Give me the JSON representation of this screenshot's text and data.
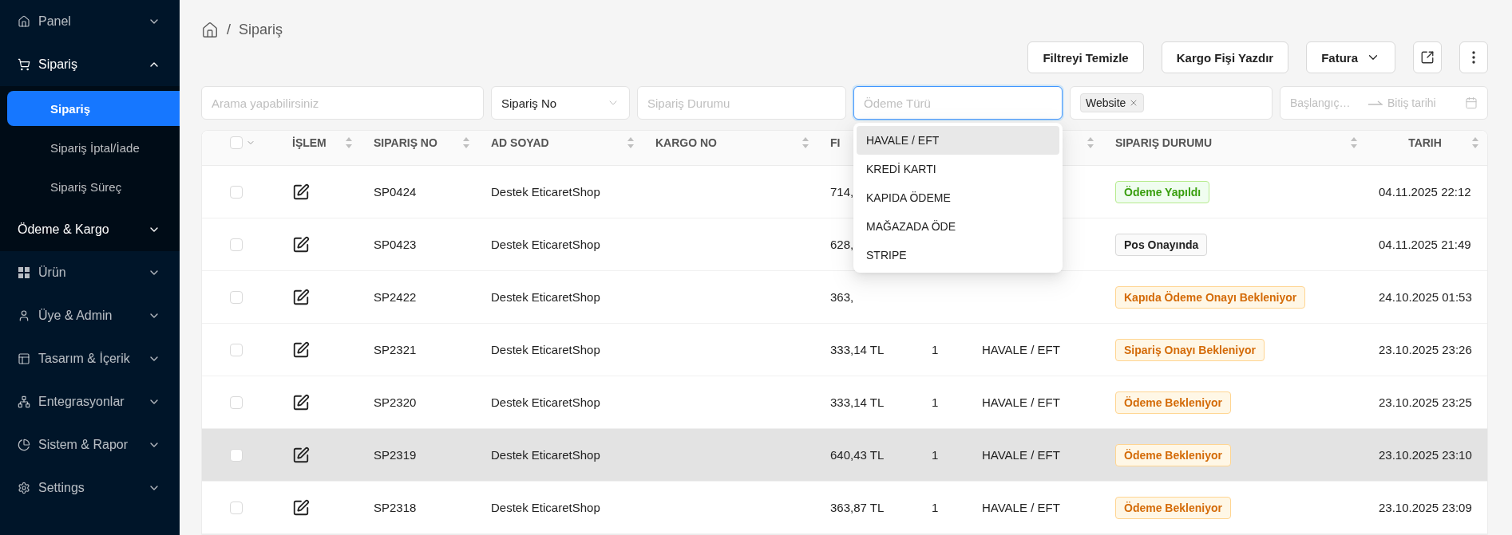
{
  "sidebar": {
    "items": [
      {
        "label": "Panel",
        "expanded": false
      },
      {
        "label": "Sipariş",
        "expanded": true,
        "children": [
          {
            "kind": "link",
            "label": "Sipariş",
            "selected": true
          },
          {
            "kind": "link",
            "label": "Sipariş İptal/İade",
            "selected": false
          },
          {
            "kind": "link",
            "label": "Sipariş Süreç",
            "selected": false
          },
          {
            "kind": "group",
            "label": "Ödeme & Kargo",
            "expanded": false
          }
        ]
      },
      {
        "label": "Ürün",
        "expanded": false
      },
      {
        "label": "Üye & Admin",
        "expanded": false
      },
      {
        "label": "Tasarım & İçerik",
        "expanded": false
      },
      {
        "label": "Entegrasyonlar",
        "expanded": false
      },
      {
        "label": "Sistem & Rapor",
        "expanded": false
      },
      {
        "label": "Settings",
        "expanded": false
      }
    ]
  },
  "breadcrumb": {
    "separator": "/",
    "current": "Sipariş"
  },
  "actions": [
    {
      "kind": "text",
      "label": "Filtreyi Temizle"
    },
    {
      "kind": "text",
      "label": "Kargo Fişi Yazdır"
    },
    {
      "kind": "menu",
      "label": "Fatura"
    },
    {
      "kind": "export"
    },
    {
      "kind": "more"
    }
  ],
  "filters": {
    "search": {
      "placeholder": "Arama yapabilirsiniz"
    },
    "search_field": {
      "value": "Sipariş No"
    },
    "order_status": {
      "placeholder": "Sipariş Durumu"
    },
    "payment_type": {
      "placeholder": "Ödeme Türü",
      "focused": true,
      "options": [
        {
          "label": "HAVALE / EFT",
          "selected": true
        },
        {
          "label": "KREDİ KARTI",
          "selected": false
        },
        {
          "label": "KAPIDA ÖDEME",
          "selected": false
        },
        {
          "label": "MAĞAZADA ÖDE",
          "selected": false
        },
        {
          "label": "STRIPE",
          "selected": false
        }
      ]
    },
    "source": {
      "tags": [
        "Website"
      ]
    },
    "date_range": {
      "start_placeholder": "Başlangıç…",
      "end_placeholder": "Bitiş tarihi"
    }
  },
  "table": {
    "select_all": {
      "checked": false
    },
    "columns": [
      {
        "label": "İŞLEM",
        "sortable": true
      },
      {
        "label": "SIPARIŞ NO",
        "sortable": true
      },
      {
        "label": "AD SOYAD",
        "sortable": true
      },
      {
        "label": "KARGO NO",
        "sortable": true
      },
      {
        "label": "FI"
      },
      {},
      {
        "sortable": true
      },
      {
        "label": "SIPARIŞ DURUMU",
        "sortable": true
      },
      {
        "label": "TARIH",
        "sortable": true
      }
    ],
    "rows": [
      {
        "checked": false,
        "highlighted": false,
        "order_no": "SP0424",
        "name": "Destek EticaretShop",
        "price": "714,",
        "status": {
          "label": "Ödeme Yapıldı",
          "kind": "success"
        },
        "date": "04.11.2025 22:12"
      },
      {
        "checked": false,
        "highlighted": false,
        "order_no": "SP0423",
        "name": "Destek EticaretShop",
        "price": "628,",
        "status": {
          "label": "Pos Onayında",
          "kind": "default"
        },
        "date": "04.11.2025 21:49"
      },
      {
        "checked": false,
        "highlighted": false,
        "order_no": "SP2422",
        "name": "Destek EticaretShop",
        "price": "363,",
        "status": {
          "label": "Kapıda Ödeme Onayı Bekleniyor",
          "kind": "warning"
        },
        "date": "24.10.2025 01:53"
      },
      {
        "checked": false,
        "highlighted": false,
        "order_no": "SP2321",
        "name": "Destek EticaretShop",
        "price": "333,14 TL",
        "count": "1",
        "payment": "HAVALE / EFT",
        "status": {
          "label": "Sipariş Onayı Bekleniyor",
          "kind": "warning"
        },
        "date": "23.10.2025 23:26"
      },
      {
        "checked": false,
        "highlighted": false,
        "order_no": "SP2320",
        "name": "Destek EticaretShop",
        "price": "333,14 TL",
        "count": "1",
        "payment": "HAVALE / EFT",
        "status": {
          "label": "Ödeme Bekleniyor",
          "kind": "warning"
        },
        "date": "23.10.2025 23:25"
      },
      {
        "checked": false,
        "highlighted": true,
        "order_no": "SP2319",
        "name": "Destek EticaretShop",
        "price": "640,43 TL",
        "count": "1",
        "payment": "HAVALE / EFT",
        "status": {
          "label": "Ödeme Bekleniyor",
          "kind": "warning"
        },
        "date": "23.10.2025 23:10"
      },
      {
        "checked": false,
        "highlighted": false,
        "order_no": "SP2318",
        "name": "Destek EticaretShop",
        "price": "363,87 TL",
        "count": "1",
        "payment": "HAVALE / EFT",
        "status": {
          "label": "Ödeme Bekleniyor",
          "kind": "warning"
        },
        "date": "23.10.2025 23:09"
      }
    ]
  }
}
